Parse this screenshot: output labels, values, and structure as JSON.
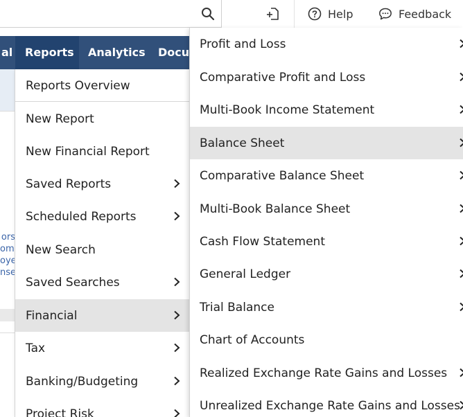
{
  "toolbar": {
    "help_label": "Help",
    "feedback_label": "Feedback"
  },
  "nav": {
    "items": [
      {
        "label": "al",
        "active": false
      },
      {
        "label": "Reports",
        "active": true
      },
      {
        "label": "Analytics",
        "active": false
      },
      {
        "label": "Docu",
        "active": false
      }
    ]
  },
  "background": {
    "links": [
      "ors",
      "ome",
      "oye",
      "nse"
    ]
  },
  "reports_menu": {
    "items": [
      {
        "label": "Reports Overview",
        "submenu": false
      },
      {
        "label": "New Report",
        "submenu": false
      },
      {
        "label": "New Financial Report",
        "submenu": false
      },
      {
        "label": "Saved Reports",
        "submenu": true
      },
      {
        "label": "Scheduled Reports",
        "submenu": true
      },
      {
        "label": "New Search",
        "submenu": false
      },
      {
        "label": "Saved Searches",
        "submenu": true
      },
      {
        "label": "Financial",
        "submenu": true,
        "highlighted": true
      },
      {
        "label": "Tax",
        "submenu": true
      },
      {
        "label": "Banking/Budgeting",
        "submenu": true
      },
      {
        "label": "Project Risk",
        "submenu": true
      }
    ]
  },
  "financial_menu": {
    "items": [
      {
        "label": "Profit and Loss",
        "submenu": true
      },
      {
        "label": "Comparative Profit and Loss",
        "submenu": true
      },
      {
        "label": "Multi-Book Income Statement",
        "submenu": true
      },
      {
        "label": "Balance Sheet",
        "submenu": true,
        "highlighted": true
      },
      {
        "label": "Comparative Balance Sheet",
        "submenu": true
      },
      {
        "label": "Multi-Book Balance Sheet",
        "submenu": true
      },
      {
        "label": "Cash Flow Statement",
        "submenu": true
      },
      {
        "label": "General Ledger",
        "submenu": true
      },
      {
        "label": "Trial Balance",
        "submenu": true
      },
      {
        "label": "Chart of Accounts",
        "submenu": false
      },
      {
        "label": "Realized Exchange Rate Gains and Losses",
        "submenu": true
      },
      {
        "label": "Unrealized Exchange Rate Gains and Losses",
        "submenu": true
      }
    ]
  },
  "colors": {
    "nav_bg": "#31507a",
    "nav_active": "#22436f",
    "highlight": "#e4e4e4",
    "link": "#3a64a8"
  }
}
